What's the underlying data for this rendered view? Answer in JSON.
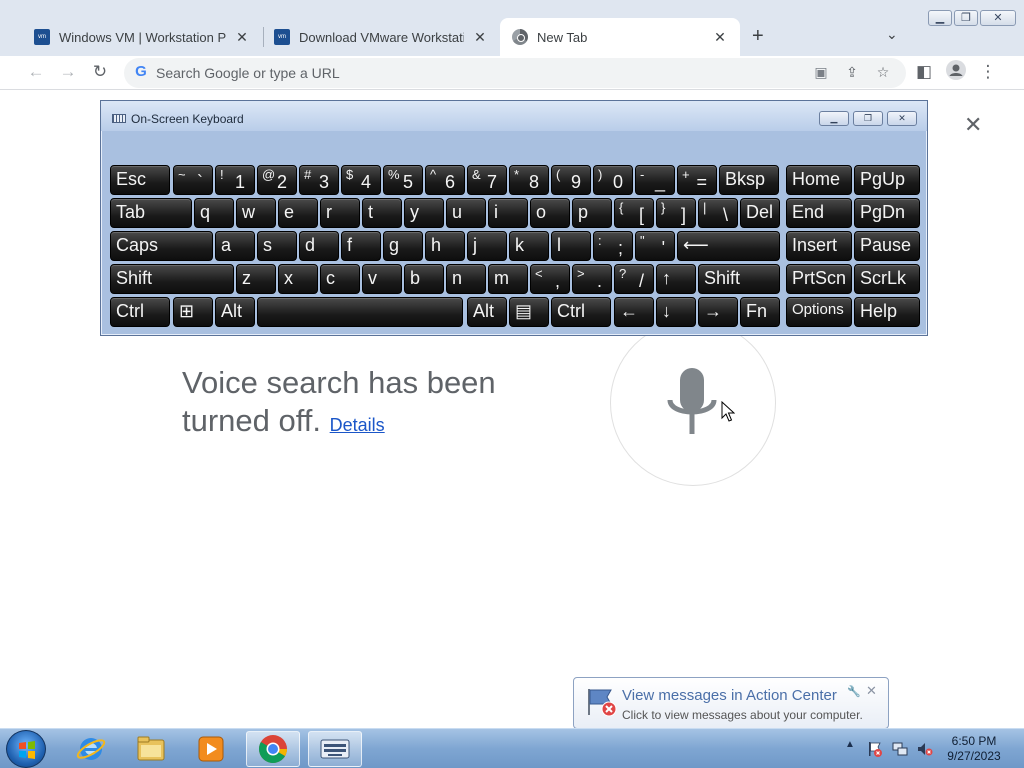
{
  "browser": {
    "tabs": [
      {
        "title": "Windows VM | Workstation Pro |",
        "favicon": "vmware-icon",
        "active": false
      },
      {
        "title": "Download VMware Workstation P",
        "favicon": "vmware-icon",
        "active": false
      },
      {
        "title": "New Tab",
        "favicon": "chrome-icon",
        "active": true
      }
    ],
    "omnibox_placeholder": "Search Google or type a URL",
    "window_controls": [
      "minimize",
      "restore",
      "close"
    ]
  },
  "page": {
    "voice_message": "Voice search has been turned off.",
    "details_link": "Details"
  },
  "osk": {
    "title": "On-Screen Keyboard",
    "rows": [
      [
        {
          "label": "Esc"
        },
        {
          "shift": "~",
          "main": "`"
        },
        {
          "shift": "!",
          "main": "1"
        },
        {
          "shift": "@",
          "main": "2"
        },
        {
          "shift": "#",
          "main": "3"
        },
        {
          "shift": "$",
          "main": "4"
        },
        {
          "shift": "%",
          "main": "5"
        },
        {
          "shift": "^",
          "main": "6"
        },
        {
          "shift": "&",
          "main": "7"
        },
        {
          "shift": "*",
          "main": "8"
        },
        {
          "shift": "(",
          "main": "9"
        },
        {
          "shift": ")",
          "main": "0"
        },
        {
          "shift": "-",
          "main": "_"
        },
        {
          "shift": "+",
          "main": "="
        },
        {
          "label": "Bksp"
        },
        {
          "label": "Home"
        },
        {
          "label": "PgUp"
        }
      ],
      [
        {
          "label": "Tab"
        },
        {
          "label": "q"
        },
        {
          "label": "w"
        },
        {
          "label": "e"
        },
        {
          "label": "r"
        },
        {
          "label": "t"
        },
        {
          "label": "y"
        },
        {
          "label": "u"
        },
        {
          "label": "i"
        },
        {
          "label": "o"
        },
        {
          "label": "p"
        },
        {
          "shift": "{",
          "main": "["
        },
        {
          "shift": "}",
          "main": "]"
        },
        {
          "shift": "|",
          "main": "\\"
        },
        {
          "label": "Del"
        },
        {
          "label": "End"
        },
        {
          "label": "PgDn"
        }
      ],
      [
        {
          "label": "Caps"
        },
        {
          "label": "a"
        },
        {
          "label": "s"
        },
        {
          "label": "d"
        },
        {
          "label": "f"
        },
        {
          "label": "g"
        },
        {
          "label": "h"
        },
        {
          "label": "j"
        },
        {
          "label": "k"
        },
        {
          "label": "l"
        },
        {
          "shift": ":",
          "main": ";"
        },
        {
          "shift": "\"",
          "main": "'"
        },
        {
          "label": "⟵"
        },
        {
          "label": "Insert"
        },
        {
          "label": "Pause"
        }
      ],
      [
        {
          "label": "Shift"
        },
        {
          "label": "z"
        },
        {
          "label": "x"
        },
        {
          "label": "c"
        },
        {
          "label": "v"
        },
        {
          "label": "b"
        },
        {
          "label": "n"
        },
        {
          "label": "m"
        },
        {
          "shift": "<",
          "main": ","
        },
        {
          "shift": ">",
          "main": "."
        },
        {
          "shift": "?",
          "main": "/"
        },
        {
          "label": "↑"
        },
        {
          "label": "Shift"
        },
        {
          "label": "PrtScn"
        },
        {
          "label": "ScrLk"
        }
      ],
      [
        {
          "label": "Ctrl"
        },
        {
          "label": "⊞"
        },
        {
          "label": "Alt"
        },
        {
          "label": ""
        },
        {
          "label": "Alt"
        },
        {
          "label": "▤"
        },
        {
          "label": "Ctrl"
        },
        {
          "label": "←"
        },
        {
          "label": "↓"
        },
        {
          "label": "→"
        },
        {
          "label": "Fn"
        },
        {
          "label": "Options"
        },
        {
          "label": "Help"
        }
      ]
    ]
  },
  "balloon": {
    "title": "View messages in Action Center",
    "subtitle": "Click to view messages about your computer."
  },
  "taskbar": {
    "pinned": [
      "internet-explorer-icon",
      "windows-explorer-icon",
      "media-player-icon",
      "chrome-icon",
      "on-screen-keyboard-icon"
    ],
    "clock_time": "6:50 PM",
    "clock_date": "9/27/2023"
  }
}
